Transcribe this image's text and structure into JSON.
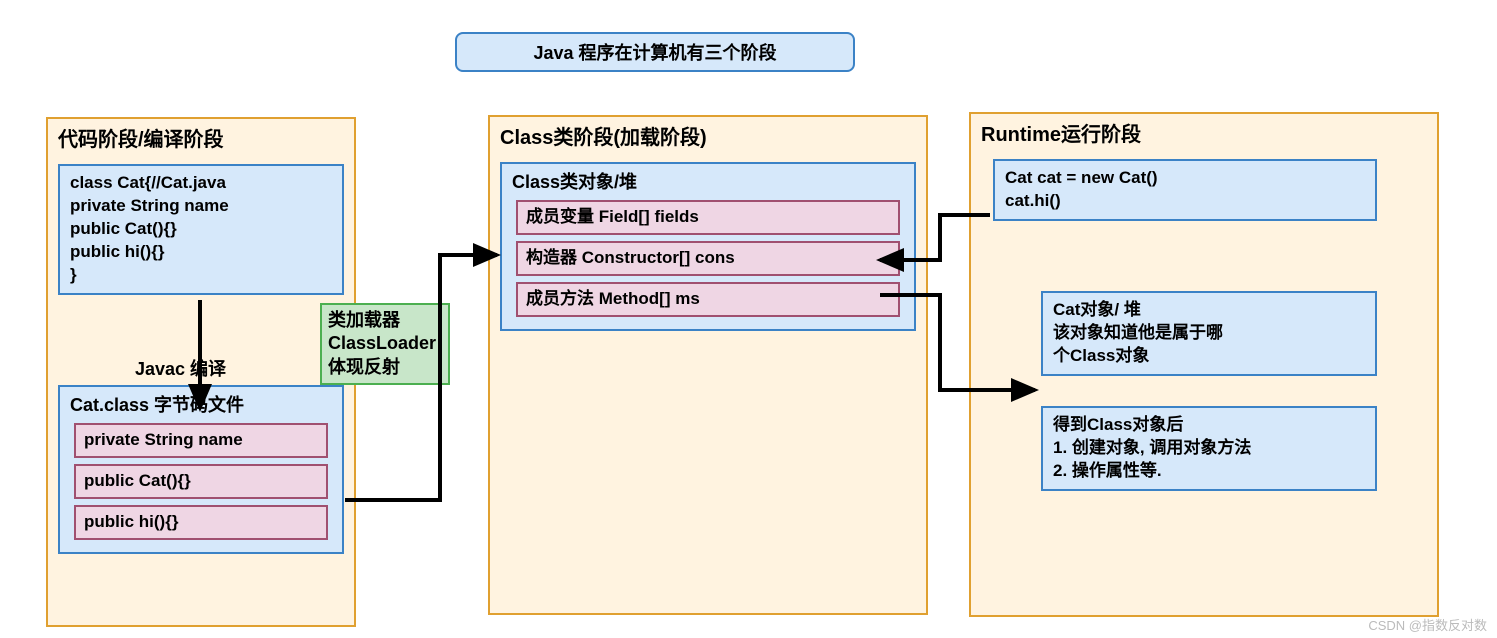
{
  "title": "Java 程序在计算机有三个阶段",
  "watermark": "CSDN @指数反对数",
  "stage1": {
    "title": "代码阶段/编译阶段",
    "code_lines": "class Cat{//Cat.java\nprivate String name\npublic Cat(){}\npublic hi(){}\n}",
    "compile_label": "Javac 编译",
    "bytecode_title": "Cat.class 字节码文件",
    "bytecode_items": {
      "a": "private String name",
      "b": "public Cat(){}",
      "c": "public hi(){}"
    }
  },
  "green": {
    "lines": "类加载器\nClassLoader\n体现反射"
  },
  "stage2": {
    "title": "Class类阶段(加载阶段)",
    "heap_title": "Class类对象/堆",
    "items": {
      "a": "成员变量 Field[] fields",
      "b": "构造器 Constructor[] cons",
      "c": "成员方法 Method[] ms"
    }
  },
  "stage3": {
    "title": "Runtime运行阶段",
    "box1": "Cat cat = new Cat()\ncat.hi()",
    "box2": "Cat对象/ 堆\n该对象知道他是属于哪\n个Class对象",
    "box3": "得到Class对象后\n1. 创建对象, 调用对象方法\n2. 操作属性等."
  }
}
